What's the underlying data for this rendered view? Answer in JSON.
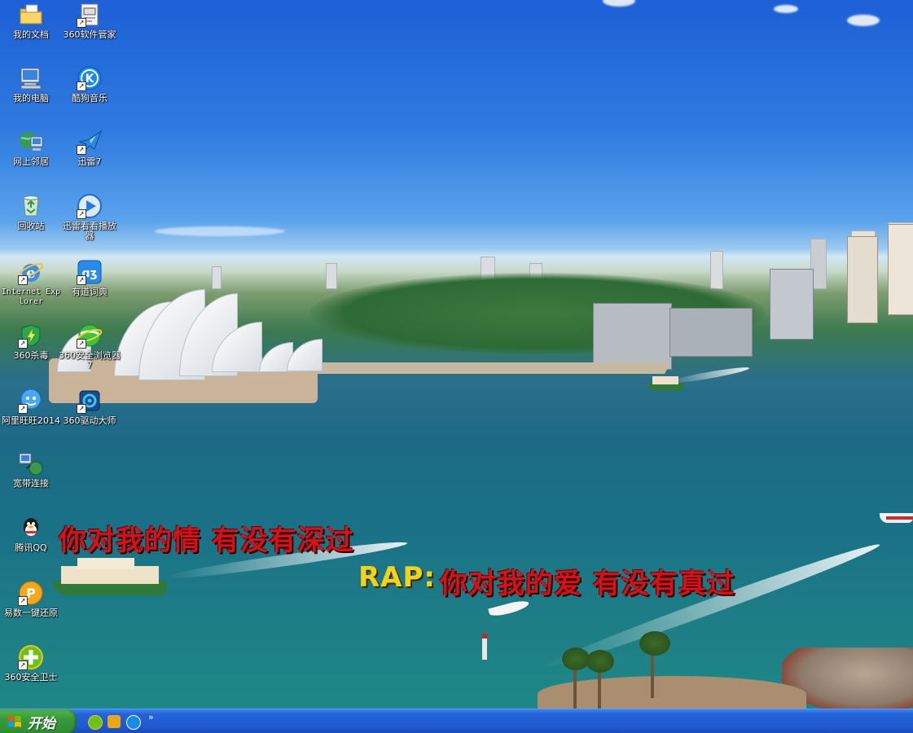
{
  "desktop_icons": [
    {
      "label": "我的文档",
      "icon": "folder-documents-icon"
    },
    {
      "label": "360软件管家",
      "icon": "software-manager-icon"
    },
    {
      "label": "我的电脑",
      "icon": "computer-icon"
    },
    {
      "label": "酷狗音乐",
      "icon": "kugou-music-icon"
    },
    {
      "label": "网上邻居",
      "icon": "network-icon"
    },
    {
      "label": "迅雷7",
      "icon": "thunder-icon"
    },
    {
      "label": "回收站",
      "icon": "recycle-bin-icon"
    },
    {
      "label": "迅雷看看播放器",
      "icon": "xunlei-player-icon"
    },
    {
      "label": "Internet Explorer",
      "icon": "ie-icon"
    },
    {
      "label": "有道词典",
      "icon": "youdao-dict-icon"
    },
    {
      "label": "360杀毒",
      "icon": "360-antivirus-icon"
    },
    {
      "label": "360安全浏览器7",
      "icon": "360-browser-icon"
    },
    {
      "label": "阿里旺旺2014",
      "icon": "aliwangwang-icon"
    },
    {
      "label": "360驱动大师",
      "icon": "360-driver-icon"
    },
    {
      "label": "宽带连接",
      "icon": "broadband-icon"
    },
    {
      "label": "腾讯QQ",
      "icon": "qq-icon"
    },
    {
      "label": "易数一键还原",
      "icon": "restore-icon"
    },
    {
      "label": "360安全卫士",
      "icon": "360-security-icon"
    }
  ],
  "lyrics": {
    "line1": "你对我的情 有没有深过",
    "line2_prefix": "RAP:",
    "line2": "你对我的爱 有没有真过"
  },
  "taskbar": {
    "start_label": "开始",
    "chevron": "»"
  },
  "colors": {
    "lyric_red": "#d4121a",
    "rap_yellow": "#f3d21a",
    "taskbar_blue": "#2463d8",
    "start_green": "#3a9a3a"
  }
}
